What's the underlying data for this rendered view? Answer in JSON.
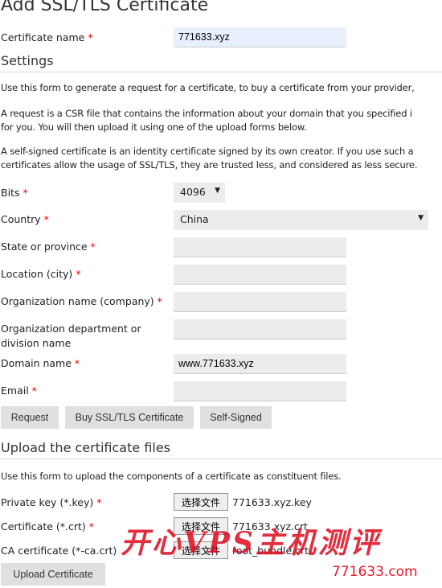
{
  "title": "Add SSL/TLS Certificate",
  "cert_name": {
    "label": "Certificate name",
    "value": "771633.xyz"
  },
  "settings": {
    "heading": "Settings",
    "p1": "Use this form to generate a request for a certificate, to buy a certificate from your provider,",
    "p2a": "A request is a CSR file that contains the information about your domain that you specified i",
    "p2b": "for you. You will then upload it using one of the upload forms below.",
    "p3a": "A self-signed certificate is an identity certificate signed by its own creator. If you use such a",
    "p3b": "certificates allow the usage of SSL/TLS, they are trusted less, and considered as less secure."
  },
  "fields": {
    "bits": {
      "label": "Bits",
      "value": "4096"
    },
    "country": {
      "label": "Country",
      "value": "China"
    },
    "state": {
      "label": "State or province",
      "value": ""
    },
    "city": {
      "label": "Location (city)",
      "value": ""
    },
    "org": {
      "label": "Organization name (company)",
      "value": ""
    },
    "dept": {
      "label1": "Organization department or",
      "label2": "division name",
      "value": ""
    },
    "domain": {
      "label": "Domain name",
      "value": "www.771633.xyz"
    },
    "email": {
      "label": "Email",
      "value": ""
    }
  },
  "required_mark": "*",
  "buttons": {
    "request": "Request",
    "buy": "Buy SSL/TLS Certificate",
    "self_signed": "Self-Signed"
  },
  "upload": {
    "heading": "Upload the certificate files",
    "desc": "Use this form to upload the components of a certificate as constituent files.",
    "choose_label": "选择文件",
    "key": {
      "label": "Private key (*.key)",
      "file": "771633.xyz.key"
    },
    "crt": {
      "label": "Certificate (*.crt)",
      "file": "771633.xyz.crt"
    },
    "ca": {
      "label": "CA certificate (*-ca.crt)",
      "file": "root_bundle.crt"
    },
    "button": "Upload Certificate"
  },
  "watermark": {
    "text": "开心VPS主机测评",
    "site": "771633.com"
  }
}
